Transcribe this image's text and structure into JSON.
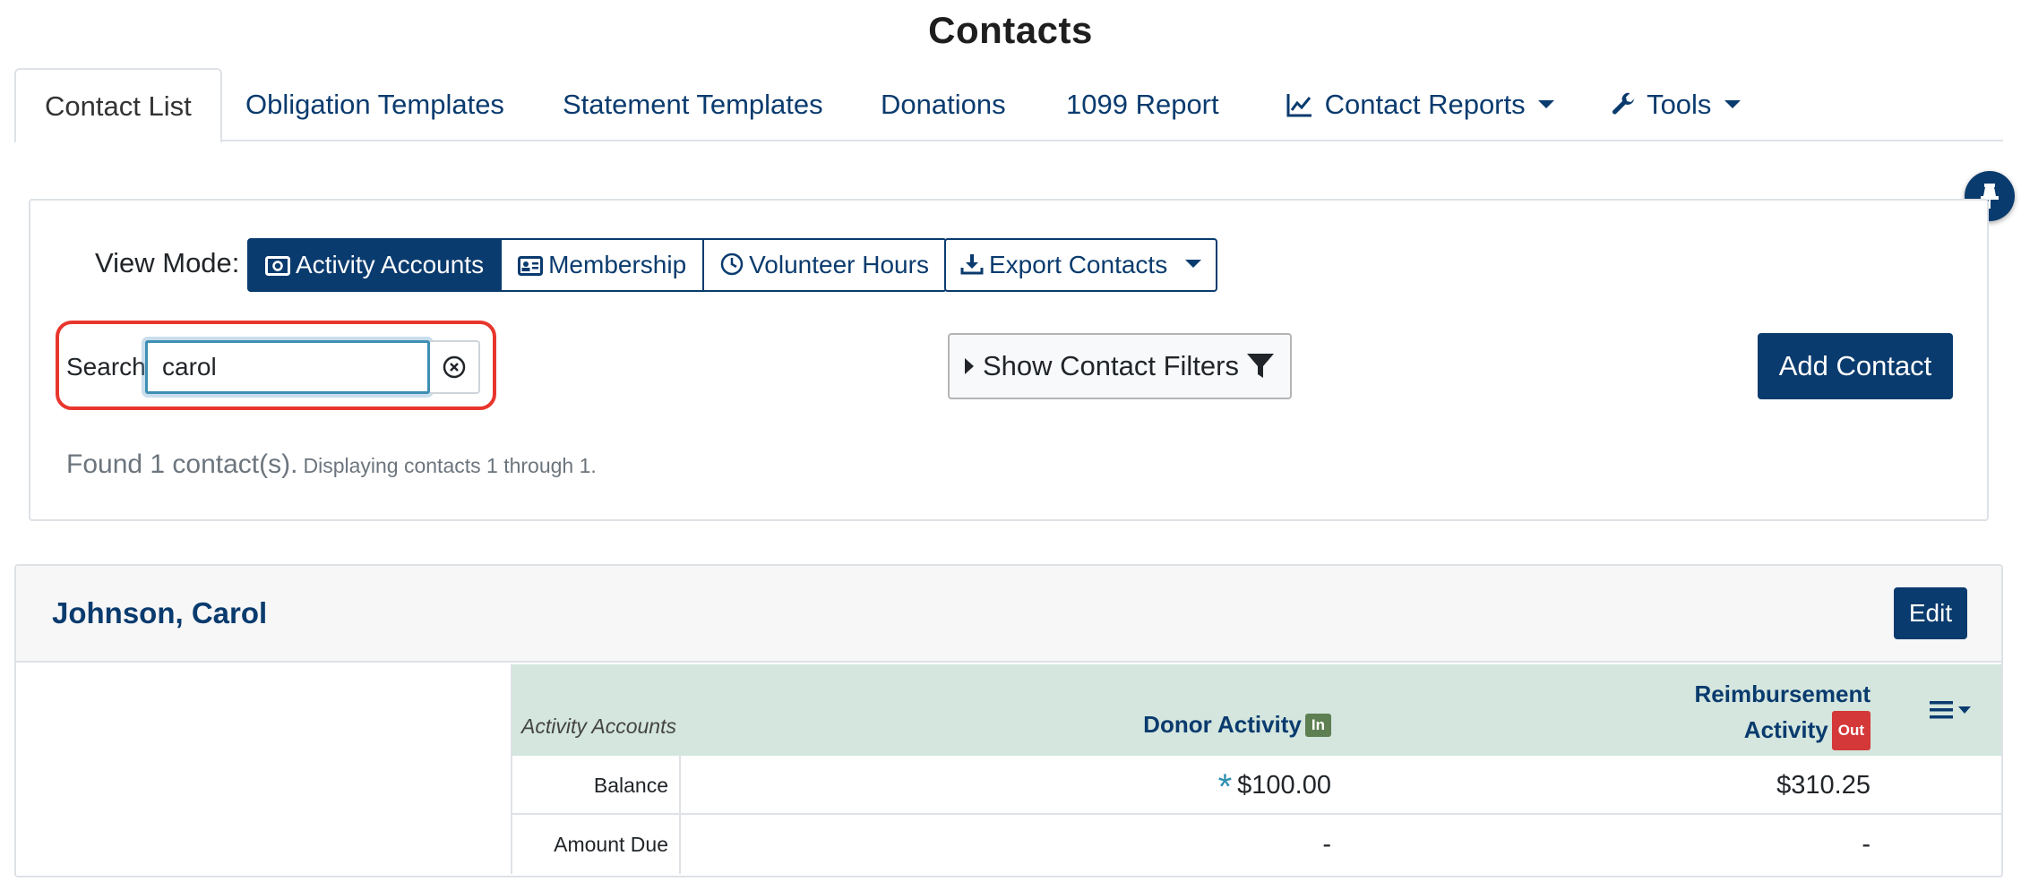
{
  "page": {
    "title": "Contacts"
  },
  "tabs": [
    {
      "label": "Contact List",
      "active": true
    },
    {
      "label": "Obligation Templates"
    },
    {
      "label": "Statement Templates"
    },
    {
      "label": "Donations"
    },
    {
      "label": "1099 Report"
    },
    {
      "label": "Contact Reports",
      "icon": "line-chart-icon",
      "dropdown": true
    },
    {
      "label": "Tools",
      "icon": "wrench-icon",
      "dropdown": true
    }
  ],
  "view_mode": {
    "label": "View Mode:",
    "options": [
      {
        "label": "Activity Accounts",
        "icon": "money-bill-icon",
        "active": true
      },
      {
        "label": "Membership",
        "icon": "id-card-icon"
      },
      {
        "label": "Volunteer Hours",
        "icon": "clock-icon"
      }
    ],
    "export_label": "Export Contacts"
  },
  "search": {
    "label": "Search",
    "value": "carol"
  },
  "filters": {
    "label": "Show Contact Filters"
  },
  "add_contact": {
    "label": "Add Contact"
  },
  "results": {
    "found": "Found 1 contact(s).",
    "displaying": "Displaying contacts 1 through 1."
  },
  "contact": {
    "name": "Johnson, Carol",
    "edit_label": "Edit",
    "accounts": {
      "caption": "Activity Accounts",
      "columns": [
        {
          "line1": "Donor Activity",
          "badge": "In"
        },
        {
          "line1": "Reimbursement",
          "line2": "Activity",
          "badge": "Out"
        }
      ],
      "rows": [
        {
          "label": "Balance",
          "donor": "$100.00",
          "reimbursement": "$310.25",
          "donor_flag": "*"
        },
        {
          "label": "Amount Due",
          "donor": "-",
          "reimbursement": "-"
        }
      ]
    }
  },
  "colors": {
    "primary": "#0a3b6e",
    "highlight": "#e8362d",
    "table_header": "#d4e6de",
    "in_badge": "#5e7f52",
    "out_badge": "#d43838"
  }
}
